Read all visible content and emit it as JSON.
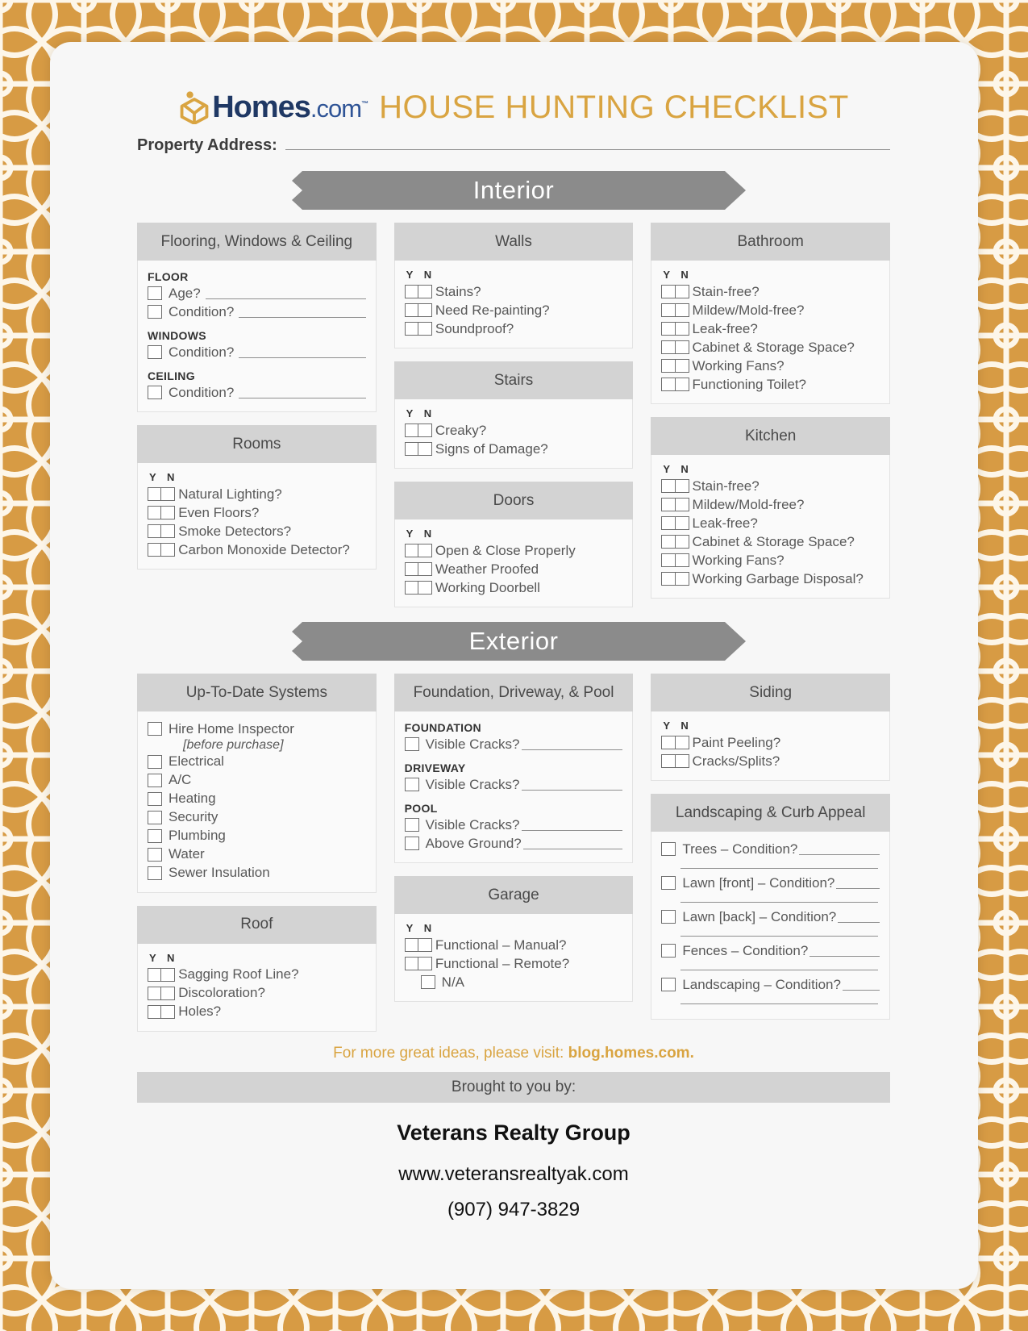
{
  "brand": {
    "logo_icon": "homes-hexagon-house-icon",
    "logo_word": "Homes",
    "logo_dotcom": ".com",
    "logo_tm": "™",
    "title": "HOUSE HUNTING CHECKLIST",
    "accent_color": "#d9a441",
    "border_color": "#d79b44",
    "banner_color": "#8b8b8b",
    "panel_head_color": "#d3d3d3"
  },
  "address": {
    "label": "Property Address:"
  },
  "banners": {
    "interior": "Interior",
    "exterior": "Exterior"
  },
  "yn_header": "Y  N",
  "interior": {
    "flooring": {
      "title": "Flooring, Windows & Ceiling",
      "groups": [
        {
          "subhead": "FLOOR",
          "items": [
            {
              "label": "Age?",
              "line": true
            },
            {
              "label": "Condition?",
              "line": true
            }
          ]
        },
        {
          "subhead": "WINDOWS",
          "items": [
            {
              "label": "Condition?",
              "line": true
            }
          ]
        },
        {
          "subhead": "CEILING",
          "items": [
            {
              "label": "Condition?",
              "line": true
            }
          ]
        }
      ]
    },
    "rooms": {
      "title": "Rooms",
      "items": [
        "Natural Lighting?",
        "Even Floors?",
        "Smoke Detectors?",
        "Carbon Monoxide Detector?"
      ]
    },
    "walls": {
      "title": "Walls",
      "items": [
        "Stains?",
        "Need Re-painting?",
        "Soundproof?"
      ]
    },
    "stairs": {
      "title": "Stairs",
      "items": [
        "Creaky?",
        "Signs of Damage?"
      ]
    },
    "doors": {
      "title": "Doors",
      "items": [
        "Open & Close Properly",
        "Weather Proofed",
        "Working Doorbell"
      ]
    },
    "bathroom": {
      "title": "Bathroom",
      "items": [
        "Stain-free?",
        "Mildew/Mold-free?",
        "Leak-free?",
        "Cabinet & Storage Space?",
        "Working Fans?",
        "Functioning Toilet?"
      ]
    },
    "kitchen": {
      "title": "Kitchen",
      "items": [
        "Stain-free?",
        "Mildew/Mold-free?",
        "Leak-free?",
        "Cabinet & Storage Space?",
        "Working Fans?",
        "Working Garbage Disposal?"
      ]
    }
  },
  "exterior": {
    "systems": {
      "title": "Up-To-Date Systems",
      "first_item": "Hire Home Inspector",
      "first_item_note": "[before purchase]",
      "items": [
        "Electrical",
        "A/C",
        "Heating",
        "Security",
        "Plumbing",
        "Water",
        "Sewer Insulation"
      ]
    },
    "roof": {
      "title": "Roof",
      "items": [
        "Sagging Roof Line?",
        "Discoloration?",
        "Holes?"
      ]
    },
    "foundation": {
      "title": "Foundation, Driveway, & Pool",
      "groups": [
        {
          "subhead": "FOUNDATION",
          "items": [
            {
              "label": "Visible Cracks?"
            }
          ]
        },
        {
          "subhead": "DRIVEWAY",
          "items": [
            {
              "label": "Visible Cracks?"
            }
          ]
        },
        {
          "subhead": "POOL",
          "items": [
            {
              "label": "Visible Cracks?"
            },
            {
              "label": "Above Ground?"
            }
          ]
        }
      ]
    },
    "garage": {
      "title": "Garage",
      "items": [
        "Functional – Manual?",
        "Functional – Remote?"
      ],
      "na_label": "N/A"
    },
    "siding": {
      "title": "Siding",
      "items": [
        "Paint Peeling?",
        "Cracks/Splits?"
      ]
    },
    "landscaping": {
      "title": "Landscaping & Curb Appeal",
      "items": [
        "Trees – Condition?",
        "Lawn [front] – Condition?",
        "Lawn [back] – Condition?",
        "Fences – Condition?",
        "Landscaping – Condition?"
      ]
    }
  },
  "footer": {
    "blog_prefix": "For more great ideas, please visit: ",
    "blog_link": "blog.homes.com.",
    "brought": "Brought to you by:",
    "company": "Veterans Realty Group",
    "website": "www.veteransrealtyak.com",
    "phone": "(907) 947-3829"
  }
}
